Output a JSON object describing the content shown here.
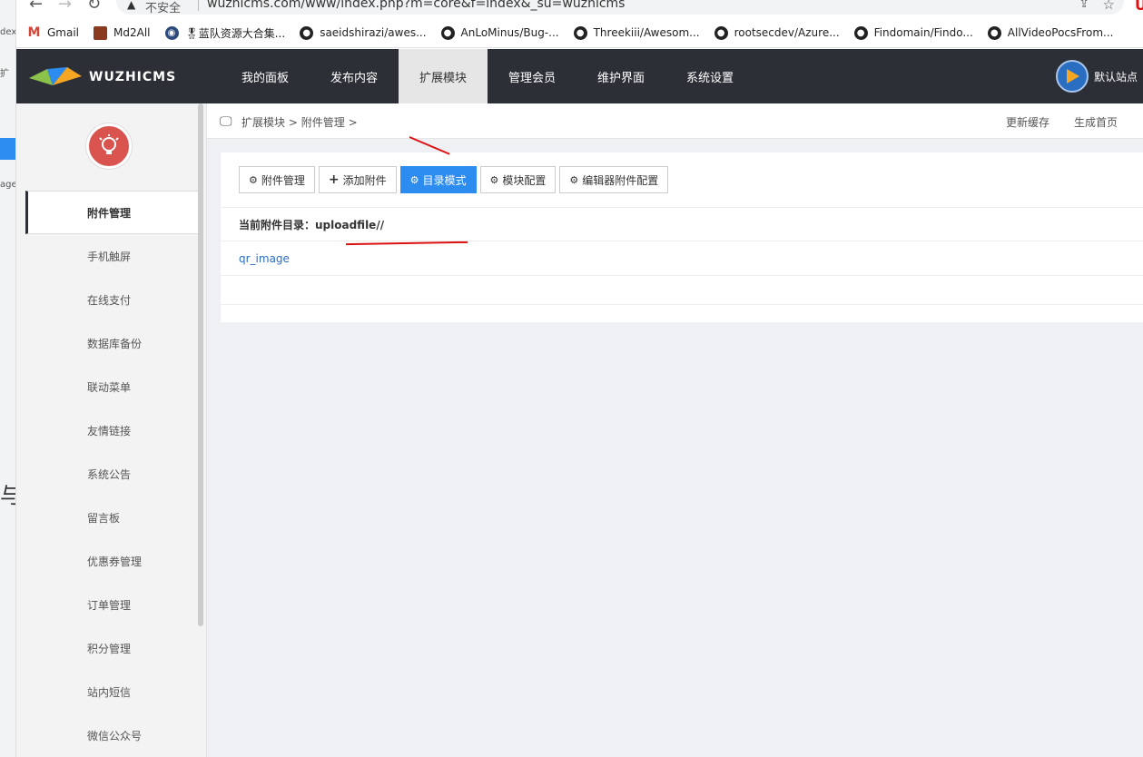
{
  "browser": {
    "insecure_label": "不安全",
    "url": "wuzhicms.com/www/index.php?m=core&f=index&_su=wuzhicms",
    "left_strip": [
      "dex",
      "扩",
      "age/"
    ],
    "left_strip_big": "与",
    "bookmarks": [
      {
        "label": "Gmail",
        "icon": "gmail-icon"
      },
      {
        "label": "Md2All",
        "icon": "md2all-icon"
      },
      {
        "label": "🎖蓝队资源大合集...",
        "icon": "site-icon"
      },
      {
        "label": "saeidshirazi/awes...",
        "icon": "github-icon"
      },
      {
        "label": "AnLoMinus/Bug-...",
        "icon": "github-icon"
      },
      {
        "label": "Threekiii/Awesom...",
        "icon": "github-icon"
      },
      {
        "label": "rootsecdev/Azure...",
        "icon": "github-icon"
      },
      {
        "label": "Findomain/Findo...",
        "icon": "github-icon"
      },
      {
        "label": "AllVideoPocsFrom...",
        "icon": "github-icon"
      }
    ]
  },
  "header": {
    "logo_text": "WUZHICMS",
    "nav": [
      {
        "label": "我的面板",
        "active": false
      },
      {
        "label": "发布内容",
        "active": false
      },
      {
        "label": "扩展模块",
        "active": true
      },
      {
        "label": "管理会员",
        "active": false
      },
      {
        "label": "维护界面",
        "active": false
      },
      {
        "label": "系统设置",
        "active": false
      }
    ],
    "site_label": "默认站点"
  },
  "sidebar": {
    "items": [
      {
        "label": "附件管理",
        "active": true
      },
      {
        "label": "手机触屏",
        "active": false
      },
      {
        "label": "在线支付",
        "active": false
      },
      {
        "label": "数据库备份",
        "active": false
      },
      {
        "label": "联动菜单",
        "active": false
      },
      {
        "label": "友情链接",
        "active": false
      },
      {
        "label": "系统公告",
        "active": false
      },
      {
        "label": "留言板",
        "active": false
      },
      {
        "label": "优惠券管理",
        "active": false
      },
      {
        "label": "订单管理",
        "active": false
      },
      {
        "label": "积分管理",
        "active": false
      },
      {
        "label": "站内短信",
        "active": false
      },
      {
        "label": "微信公众号",
        "active": false
      }
    ]
  },
  "breadcrumb": {
    "items": [
      "扩展模块",
      "附件管理"
    ],
    "separator": ">"
  },
  "top_links": {
    "update_cache": "更新缓存",
    "gen_home": "生成首页"
  },
  "toolbar": {
    "buttons": [
      {
        "label": "附件管理",
        "icon": "gears-icon",
        "primary": false
      },
      {
        "label": "添加附件",
        "icon": "plus-icon",
        "primary": false
      },
      {
        "label": "目录模式",
        "icon": "gears-icon",
        "primary": true
      },
      {
        "label": "模块配置",
        "icon": "gears-icon",
        "primary": false
      },
      {
        "label": "编辑器附件配置",
        "icon": "gears-icon",
        "primary": false
      }
    ]
  },
  "directory": {
    "label": "当前附件目录：uploadfile//",
    "entries": [
      "qr_image"
    ]
  },
  "colors": {
    "header_bg": "#2c2f36",
    "primary": "#2d8cf0",
    "bulb": "#d9534f",
    "annotation": "#dd1111"
  }
}
